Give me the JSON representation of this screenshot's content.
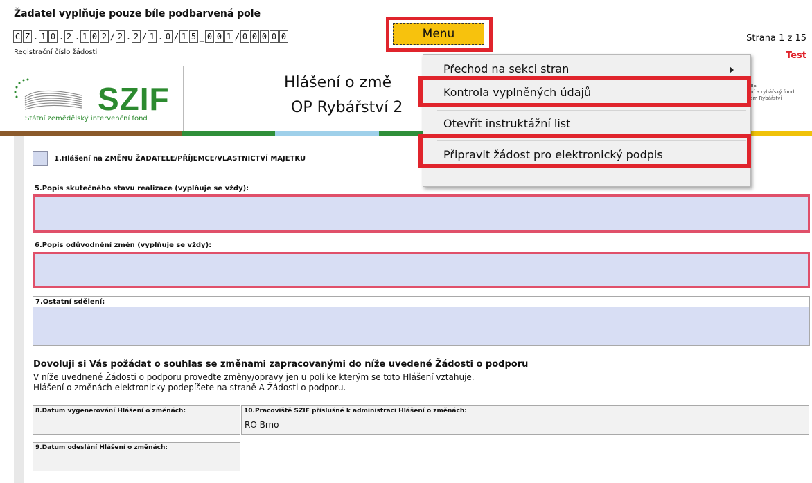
{
  "header": {
    "title": "Žadatel vyplňuje pouze bíle podbarvená pole",
    "registration_chars": [
      "C",
      "Z",
      ".",
      "1",
      "0",
      ".",
      "2",
      ".",
      "1",
      "0",
      "2",
      "/",
      "2",
      ".",
      "2",
      "/",
      "1",
      ".",
      "0",
      "/",
      "1",
      "5",
      "_",
      "0",
      "0",
      "1",
      "/",
      "0",
      "0",
      "0",
      "0",
      "0"
    ],
    "registration_label": "Registrační číslo žádosti",
    "menu_label": "Menu",
    "page_count": "Strana 1 z 15",
    "test_label": "Test"
  },
  "banner": {
    "logo_text": "SZIF",
    "logo_subtitle": "Státní zemědělský intervenční fond",
    "form_title_line1": "Hlášení o změ",
    "form_title_line2": "OP Rybářství 2",
    "eu_lines": [
      "UNIE",
      "ační a rybářský fond",
      "gram Rybářství"
    ],
    "colorbar": [
      "#8b5a2b",
      "#2f8f3a",
      "#9fd0ea",
      "#2f8f3a",
      "#f0c20a"
    ]
  },
  "dropdown": {
    "items": [
      {
        "label": "Přechod na sekci stran",
        "has_submenu": true
      },
      {
        "label": "Kontrola vyplněných údajů"
      },
      {
        "label": "Otevřít instruktážní list"
      },
      {
        "label": "Připravit žádost pro elektronický podpis"
      }
    ]
  },
  "form": {
    "checkbox1_label": "1.Hlášení na ZMĚNU ŽADATELE/PŘÍJEMCE/VLASTNICTVÍ MAJETKU",
    "field5_label": "5.Popis skutečného stavu realizace (vyplňuje se vždy):",
    "field6_label": "6.Popis odůvodnění změn (vyplňuje se vždy):",
    "field7_label": "7.Ostatní sdělení:",
    "consent_title": "Dovoluji si Vás požádat o souhlas se změnami zapracovanými do níže uvedené Žádosti o podporu",
    "consent_line1": "V níže uvednené Žádosti o podporu proveďte změny/opravy jen u polí ke kterým se toto Hlášení vztahuje.",
    "consent_line2": "Hlášení o změnách elektronicky podepíšete na straně A Žádosti o podporu.",
    "field8_label": "8.Datum vygenerování Hlášení o změnách:",
    "field10_label": "10.Pracoviště SZIF příslušné k administraci Hlášení o změnách:",
    "field10_value": "RO Brno",
    "field9_label": "9.Datum odeslání Hlášení o změnách:"
  }
}
